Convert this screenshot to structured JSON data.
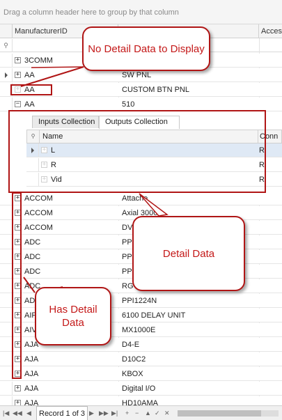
{
  "group_panel_text": "Drag a column header here to group by that column",
  "columns": {
    "manufacturer": "ManufacturerID",
    "col3": "Acces"
  },
  "rows_top": [
    {
      "id": "3COMM",
      "model": ""
    },
    {
      "id": "AA",
      "model": "SW PNL"
    },
    {
      "id": "AA",
      "model": "CUSTOM BTN PNL"
    },
    {
      "id": "AA",
      "model": "510"
    }
  ],
  "detail": {
    "tabs": [
      "Inputs Collection",
      "Outputs Collection"
    ],
    "columns": {
      "name": "Name",
      "conn": "Conn"
    },
    "rows": [
      {
        "name": "L",
        "conn": "R"
      },
      {
        "name": "R",
        "conn": "R"
      },
      {
        "name": "Vid",
        "conn": "R"
      }
    ]
  },
  "rows_bottom": [
    {
      "id": "ACCOM",
      "model": "Attache"
    },
    {
      "id": "ACCOM",
      "model": "Axial 3000"
    },
    {
      "id": "ACCOM",
      "model": "DV"
    },
    {
      "id": "ADC",
      "model": "PP"
    },
    {
      "id": "ADC",
      "model": "PP"
    },
    {
      "id": "ADC",
      "model": "PP"
    },
    {
      "id": "ADC",
      "model": "RG"
    },
    {
      "id": "AD",
      "model": "PPI1224N"
    },
    {
      "id": "AIP",
      "model": "6100 DELAY UNIT"
    },
    {
      "id": "AIV",
      "model": "MX1000E"
    },
    {
      "id": "AJA",
      "model": "D4-E"
    },
    {
      "id": "AJA",
      "model": "D10C2"
    },
    {
      "id": "AJA",
      "model": "KBOX"
    },
    {
      "id": "AJA",
      "model": "Digital I/O"
    },
    {
      "id": "AJA",
      "model": "HD10AMA"
    }
  ],
  "pager": {
    "record": "Record 1 of 3"
  },
  "callouts": {
    "no_detail": "No Detail Data to Display",
    "detail": "Detail Data",
    "has_detail": "Has Detail Data"
  },
  "colors": {
    "callout_red": "#c41818",
    "selected_row": "#dfe9f5"
  }
}
